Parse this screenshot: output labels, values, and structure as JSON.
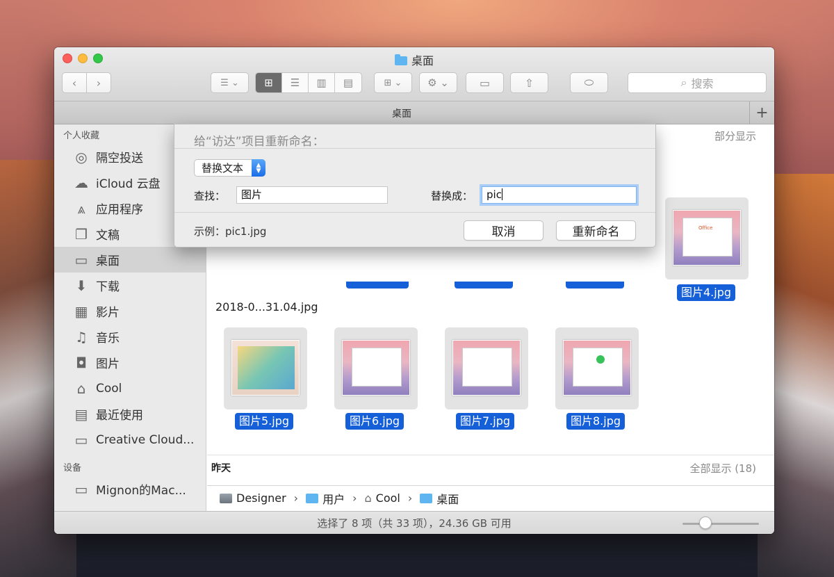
{
  "window": {
    "title": "桌面"
  },
  "toolbar": {
    "back": "‹",
    "forward": "›",
    "search_label": "搜索",
    "search_icon": "search-icon"
  },
  "tabbar": {
    "title": "桌面",
    "plus": "+"
  },
  "sidebar": {
    "favorites_header": "个人收藏",
    "items": [
      {
        "label": "隔空投送",
        "icon": "airdrop-icon"
      },
      {
        "label": "iCloud 云盘",
        "icon": "cloud-icon"
      },
      {
        "label": "应用程序",
        "icon": "applications-icon"
      },
      {
        "label": "文稿",
        "icon": "documents-icon"
      },
      {
        "label": "桌面",
        "icon": "desktop-icon",
        "selected": true
      },
      {
        "label": "下载",
        "icon": "download-icon"
      },
      {
        "label": "影片",
        "icon": "movies-icon"
      },
      {
        "label": "音乐",
        "icon": "music-icon"
      },
      {
        "label": "图片",
        "icon": "pictures-icon"
      },
      {
        "label": "Cool",
        "icon": "home-icon"
      },
      {
        "label": "最近使用",
        "icon": "recents-icon"
      },
      {
        "label": "Creative Cloud...",
        "icon": "folder-icon"
      }
    ],
    "devices_header": "设备",
    "devices": [
      {
        "label": "Mignon的Mac...",
        "icon": "laptop-icon"
      }
    ]
  },
  "content": {
    "section1_right": "部分显示",
    "partial_filename": "2018-0...31.04.jpg",
    "files": [
      {
        "name": "图片4.jpg"
      },
      {
        "name": "图片5.jpg"
      },
      {
        "name": "图片6.jpg"
      },
      {
        "name": "图片7.jpg"
      },
      {
        "name": "图片8.jpg"
      }
    ],
    "office_text": "Office",
    "section2_title": "昨天",
    "section2_right": "全部显示 (18)"
  },
  "pathbar": {
    "items": [
      {
        "label": "Designer",
        "icon": "disk-icon"
      },
      {
        "label": "用户",
        "icon": "folder-icon"
      },
      {
        "label": "Cool",
        "icon": "home-icon"
      },
      {
        "label": "桌面",
        "icon": "folder-icon"
      }
    ],
    "separator": "›"
  },
  "statusbar": {
    "text": "选择了 8 项（共 33 项），24.36 GB 可用"
  },
  "rename_sheet": {
    "title": "给“访达”项目重新命名：",
    "mode": "替换文本",
    "find_label": "查找：",
    "find_value": "图片",
    "replace_label": "替换成：",
    "replace_value": "pic",
    "example": "示例：pic1.jpg",
    "cancel": "取消",
    "rename": "重新命名"
  },
  "colors": {
    "selection": "#1560d8",
    "accent": "#1a6de8"
  }
}
